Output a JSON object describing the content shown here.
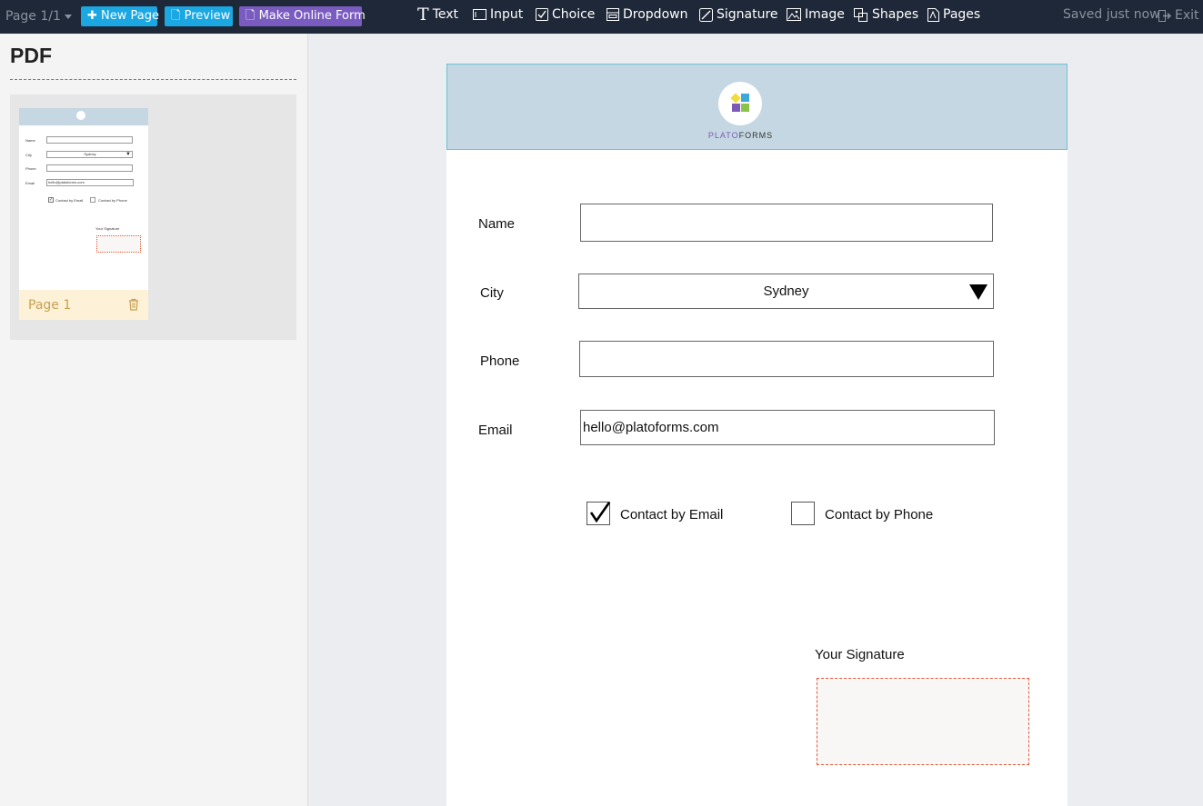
{
  "toolbar": {
    "page_indicator": "Page 1/1",
    "new_page_label": "New Page",
    "preview_label": "Preview",
    "make_online_form_label": "Make Online Form",
    "tools": {
      "text": "Text",
      "input": "Input",
      "choice": "Choice",
      "dropdown": "Dropdown",
      "signature": "Signature",
      "image": "Image",
      "shapes": "Shapes",
      "pages": "Pages"
    },
    "saved_status": "Saved just now",
    "exit_label": "Exit"
  },
  "sidebar": {
    "title": "PDF",
    "pages": [
      {
        "label": "Page 1"
      }
    ],
    "thumbnail": {
      "name_label": "Name",
      "city_label": "City",
      "city_value": "Sydney",
      "phone_label": "Phone",
      "email_label": "Email",
      "email_value": "hello@platoforms.com",
      "contact_email": "Contact by Email",
      "contact_phone": "Contact by Phone",
      "signature_label": "Your Signature"
    }
  },
  "form": {
    "logo": {
      "plato": "PLATO",
      "forms": "FORMS"
    },
    "name_label": "Name",
    "name_value": "",
    "city_label": "City",
    "city_value": "Sydney",
    "phone_label": "Phone",
    "phone_value": "",
    "email_label": "Email",
    "email_value": "hello@platoforms.com",
    "contact_email_label": "Contact by Email",
    "contact_email_checked": true,
    "contact_phone_label": "Contact by Phone",
    "contact_phone_checked": false,
    "signature_label": "Your Signature"
  },
  "colors": {
    "topbar": "#1f2838",
    "accent_blue": "#1ba7e1",
    "accent_purple": "#7a5cc0",
    "header_band": "#c4d7e2",
    "signature_border": "#e05a3a"
  }
}
